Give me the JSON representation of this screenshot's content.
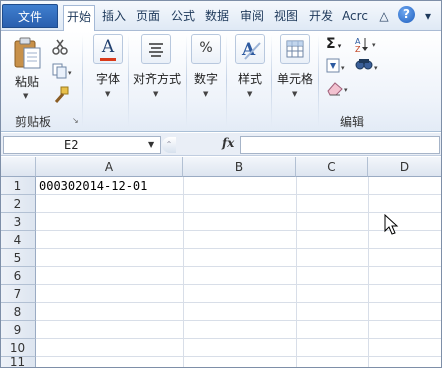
{
  "ribbon_tabs": {
    "file": "文件",
    "home": "开始",
    "insert": "插入",
    "page": "页面",
    "formulas": "公式",
    "data": "数据",
    "review": "审阅",
    "view": "视图",
    "developer": "开发",
    "acrobat": "Acrc"
  },
  "ribbon": {
    "paste": "粘贴",
    "clipboard_group": "剪贴板",
    "font": "字体",
    "alignment": "对齐方式",
    "number": "数字",
    "styles": "样式",
    "cells": "单元格",
    "editing_group": "编辑",
    "sigma": "Σ",
    "number_icon_text": "%",
    "font_icon_text": "A"
  },
  "formula_bar": {
    "name_box": "E2",
    "fx": "fx"
  },
  "sheet": {
    "columns": [
      "A",
      "B",
      "C",
      "D"
    ],
    "rows": [
      "1",
      "2",
      "3",
      "4",
      "5",
      "6",
      "7",
      "8",
      "9",
      "10",
      "11"
    ],
    "cell_a1": "000302014-12-01"
  },
  "colors": {
    "accent": "#2a5fae",
    "header_selected": "#f2c96a"
  }
}
